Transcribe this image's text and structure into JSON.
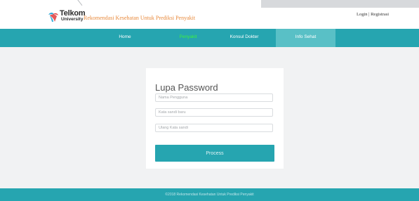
{
  "header": {
    "brand_name": "Telkom",
    "brand_subtitle": "University",
    "site_title": "Rekomendasi Kesehatan Untuk Prediksi Penyakit",
    "login_label": "Login",
    "separator": " | ",
    "register_label": "Registrasi"
  },
  "nav": {
    "items": [
      {
        "label": "Home"
      },
      {
        "label": "Penyakit"
      },
      {
        "label": "Konsul Dokter"
      },
      {
        "label": "Info Sehat"
      }
    ],
    "active_index": 1,
    "highlight_index": 3
  },
  "form": {
    "title": "Lupa Password",
    "username_placeholder": "Nama Pengguna",
    "new_password_placeholder": "Kata sandi baru",
    "repeat_password_placeholder": "Ulang Kata sandi",
    "submit_label": "Process"
  },
  "footer": {
    "text": "©2018 Rekomendasi Kesehatan Untuk Prediksi Penyakit"
  },
  "colors": {
    "accent": "#26a5b0",
    "nav_highlight": "#59c0c6",
    "active_nav": "#3df03d",
    "title_orange": "#e8893b",
    "background": "#f1f2f3"
  },
  "icons": {
    "logo": "telkom-university-logo"
  }
}
